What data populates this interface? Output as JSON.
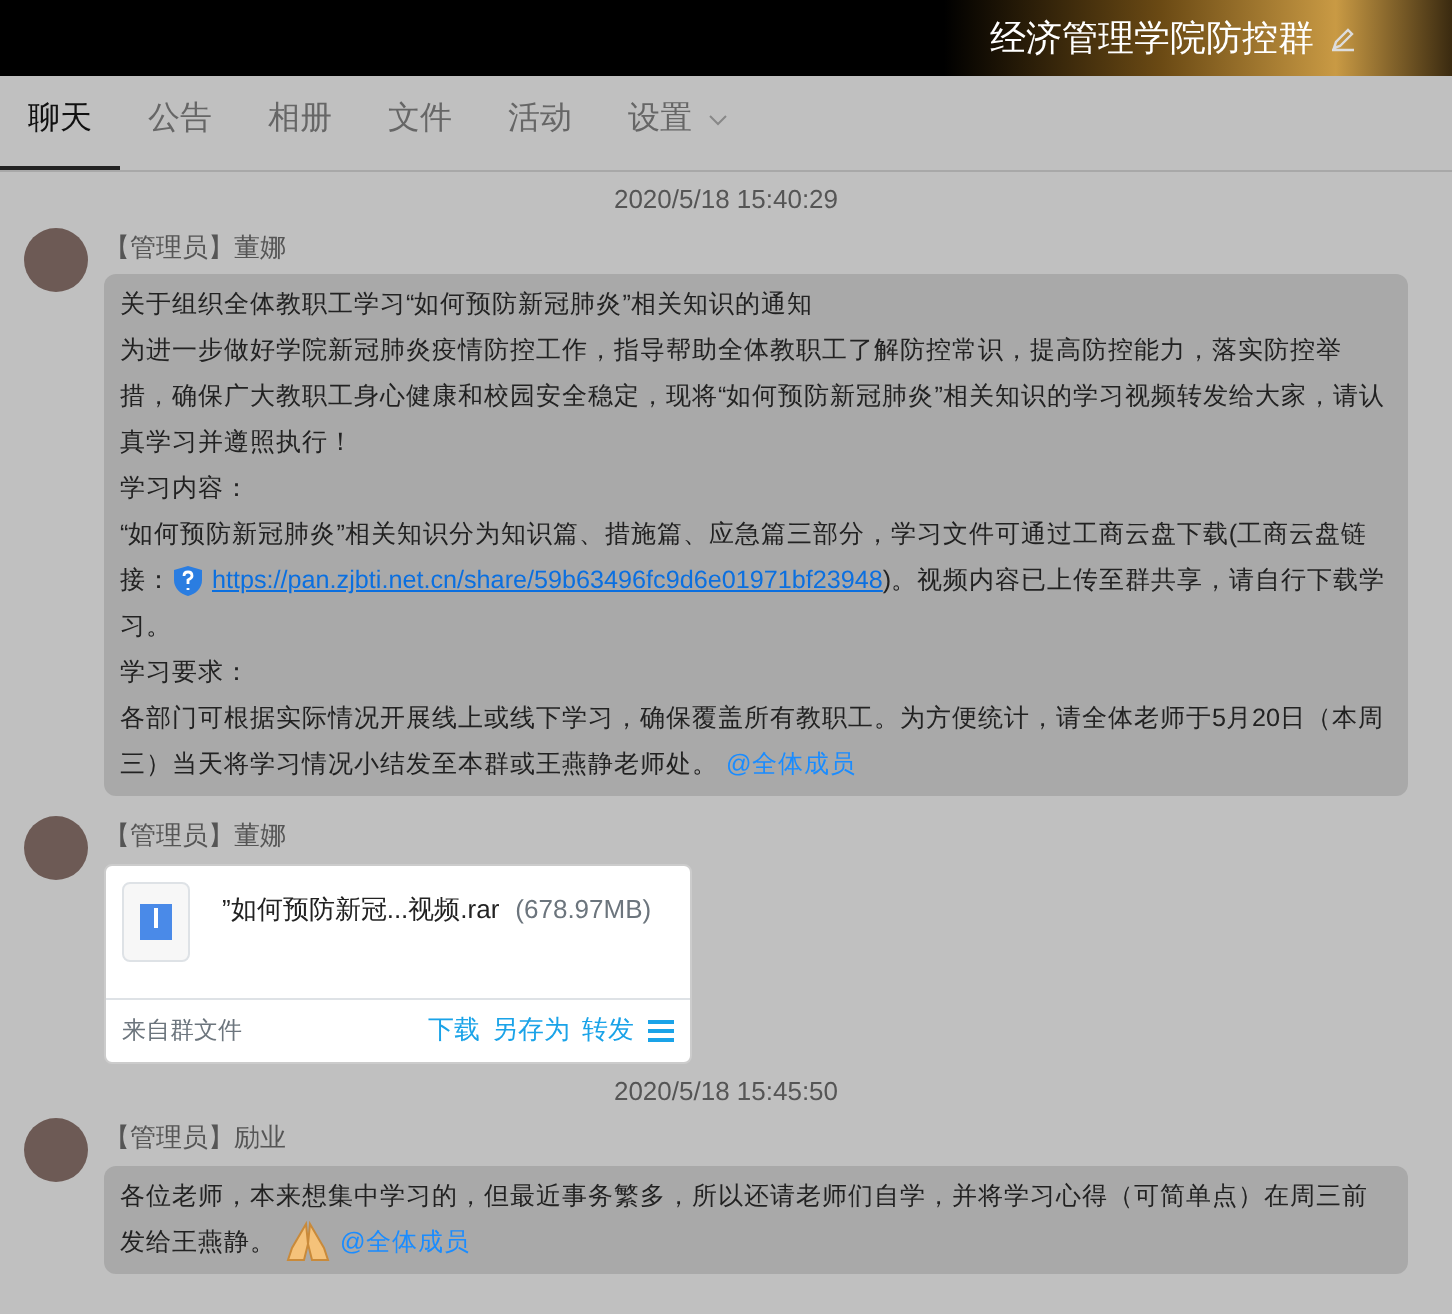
{
  "window": {
    "title": "经济管理学院防控群"
  },
  "tabs": [
    {
      "label": "聊天",
      "selected": true,
      "dropdown": false
    },
    {
      "label": "公告",
      "selected": false,
      "dropdown": false
    },
    {
      "label": "相册",
      "selected": false,
      "dropdown": false
    },
    {
      "label": "文件",
      "selected": false,
      "dropdown": false
    },
    {
      "label": "活动",
      "selected": false,
      "dropdown": false
    },
    {
      "label": "设置",
      "selected": false,
      "dropdown": true
    }
  ],
  "messages": [
    {
      "kind": "timestamp",
      "text": "2020/5/18 15:40:29"
    },
    {
      "kind": "text",
      "sender": "【管理员】董娜",
      "paragraphs": [
        [
          {
            "kind": "text",
            "text": "关于组织全体教职工学习“如何预防新冠肺炎”相关知识的通知"
          }
        ],
        [
          {
            "kind": "text",
            "text": "为进一步做好学院新冠肺炎疫情防控工作，指导帮助全体教职工了解防控常识，提高防控能力，落实防控举措，确保广大教职工身心健康和校园安全稳定，现将“如何预防新冠肺炎”相关知识的学习视频转发给大家，请认真学习并遵照执行！"
          }
        ],
        [
          {
            "kind": "text",
            "text": "学习内容："
          }
        ],
        [
          {
            "kind": "text",
            "text": "“如何预防新冠肺炎”相关知识分为知识篇、措施篇、应急篇三部分，学习文件可通过工商云盘下载(工商云盘链接："
          },
          {
            "kind": "link",
            "text": "https://pan.zjbti.net.cn/share/59b63496fc9d6e01971bf23948"
          },
          {
            "kind": "text",
            "text": ")。视频内容已上传至群共享，请自行下载学习。"
          }
        ],
        [
          {
            "kind": "text",
            "text": "学习要求："
          }
        ],
        [
          {
            "kind": "text",
            "text": "各部门可根据实际情况开展线上或线下学习，确保覆盖所有教职工。为方便统计，请全体老师于5月20日（本周三）当天将学习情况小结发至本群或王燕静老师处。"
          },
          {
            "kind": "mention",
            "text": "@全体成员"
          }
        ]
      ]
    },
    {
      "kind": "file",
      "sender": "【管理员】董娜",
      "file_name": "”如何预防新冠...视频.rar",
      "size": "(678.97MB)",
      "source": "来自群文件",
      "actions": [
        "下载",
        "另存为",
        "转发"
      ]
    },
    {
      "kind": "timestamp",
      "text": "2020/5/18 15:45:50"
    },
    {
      "kind": "text",
      "sender": "【管理员】励业",
      "paragraphs": [
        [
          {
            "kind": "text",
            "text": "各位老师，本来想集中学习的，但最近事务繁多，所以还请老师们自学，并将学习心得（可简单点）在周三前发给王燕静。"
          },
          {
            "kind": "emoji"
          },
          {
            "kind": "mention",
            "text": "@全体成员"
          }
        ]
      ]
    }
  ]
}
